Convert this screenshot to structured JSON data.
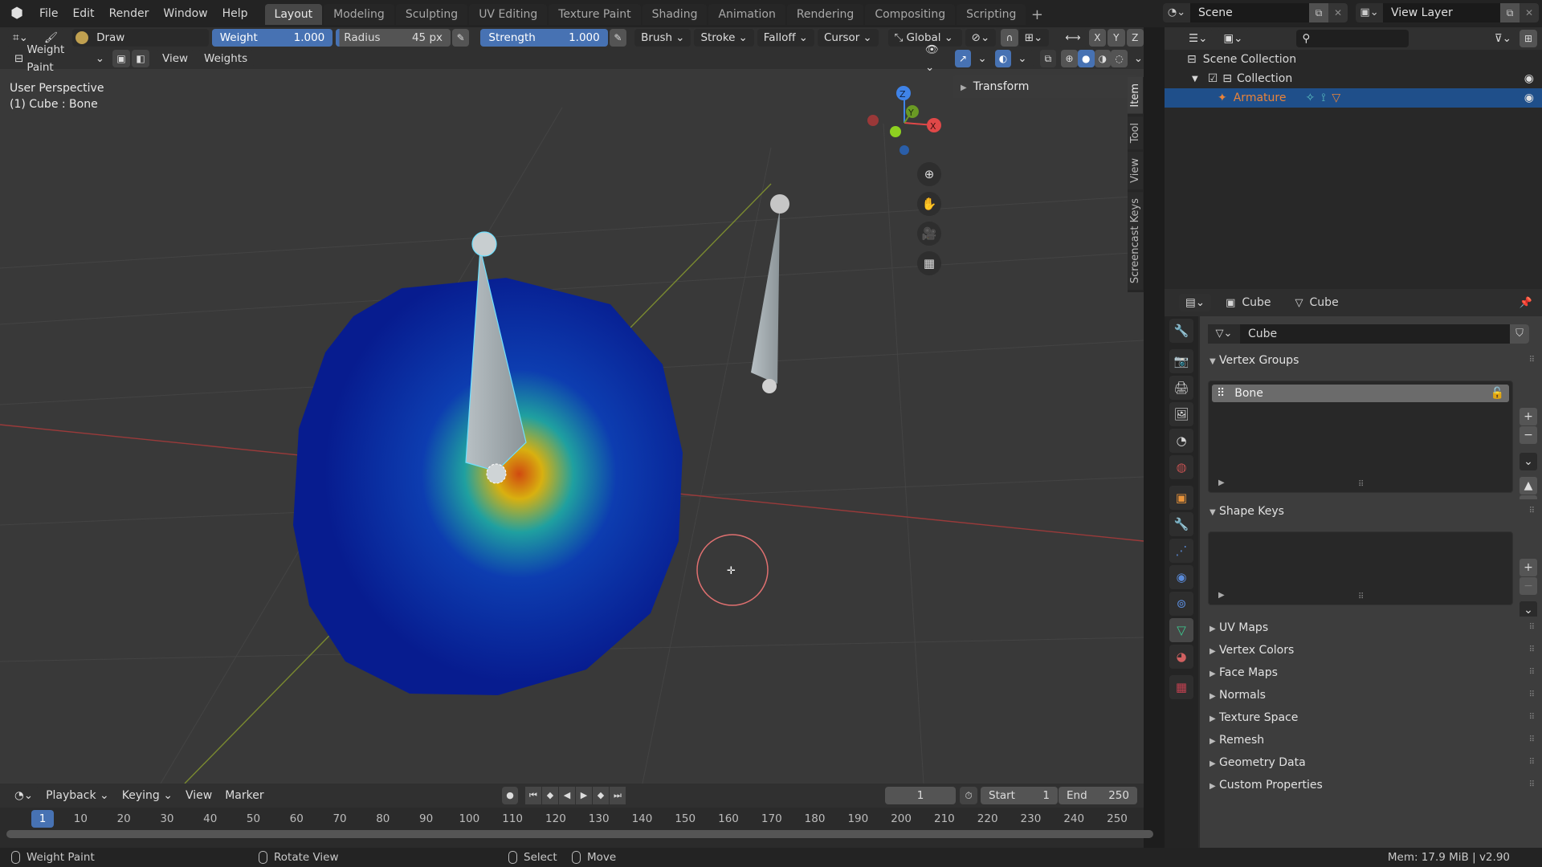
{
  "menubar": {
    "menus": [
      "File",
      "Edit",
      "Render",
      "Window",
      "Help"
    ],
    "workspaces": [
      "Layout",
      "Modeling",
      "Sculpting",
      "UV Editing",
      "Texture Paint",
      "Shading",
      "Animation",
      "Rendering",
      "Compositing",
      "Scripting"
    ],
    "active_workspace": "Layout",
    "scene": "Scene",
    "view_layer": "View Layer"
  },
  "tool_header": {
    "brush_name": "Draw",
    "weight_label": "Weight",
    "weight_value": "1.000",
    "radius_label": "Radius",
    "radius_value": "45 px",
    "strength_label": "Strength",
    "strength_value": "1.000",
    "dropdowns": [
      "Brush",
      "Stroke",
      "Falloff",
      "Cursor"
    ],
    "orientation": "Global",
    "axes": [
      "X",
      "Y",
      "Z"
    ]
  },
  "mode_header": {
    "mode": "Weight Paint",
    "menus": [
      "View",
      "Weights"
    ]
  },
  "viewport": {
    "view_name": "User Perspective",
    "object_info": "(1) Cube : Bone",
    "npanel_title": "Transform",
    "npanel_tabs": [
      "Item",
      "Tool",
      "View",
      "Screencast Keys"
    ],
    "gizmo_axes": [
      "X",
      "Y",
      "Z"
    ],
    "accent_blue": "#4772b3"
  },
  "timeline": {
    "menus": [
      "Playback",
      "Keying",
      "View",
      "Marker"
    ],
    "current_frame": "1",
    "start_label": "Start",
    "start_value": "1",
    "end_label": "End",
    "end_value": "250",
    "ticks": [
      "10",
      "20",
      "30",
      "40",
      "50",
      "60",
      "70",
      "80",
      "90",
      "100",
      "110",
      "120",
      "130",
      "140",
      "150",
      "160",
      "170",
      "180",
      "190",
      "200",
      "210",
      "220",
      "230",
      "240",
      "250"
    ]
  },
  "statusbar": {
    "left": "Weight Paint",
    "middle": "Rotate View",
    "select": "Select",
    "move": "Move",
    "info": "Mem: 17.9 MiB | v2.90"
  },
  "outliner": {
    "root": "Scene Collection",
    "collection": "Collection",
    "selected_object": "Armature",
    "selected_color": "#e8833a"
  },
  "properties": {
    "context_object": "Cube",
    "context_data": "Cube",
    "mesh_name": "Cube",
    "vertex_groups_title": "Vertex Groups",
    "vertex_groups": [
      "Bone"
    ],
    "shape_keys_title": "Shape Keys",
    "collapsed_panels": [
      "UV Maps",
      "Vertex Colors",
      "Face Maps",
      "Normals",
      "Texture Space",
      "Remesh",
      "Geometry Data",
      "Custom Properties"
    ]
  }
}
